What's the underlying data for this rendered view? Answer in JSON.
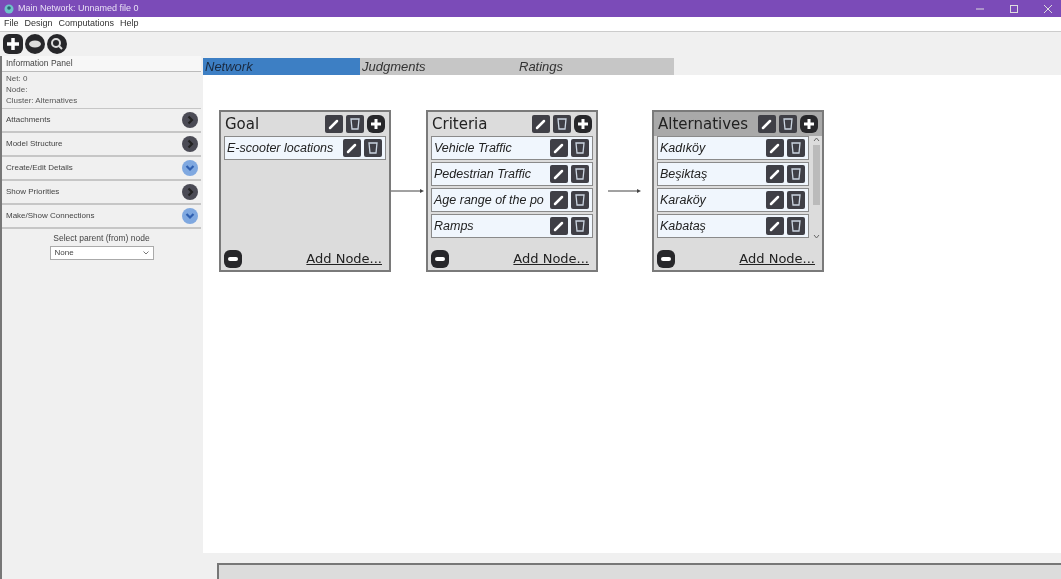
{
  "window": {
    "title": "Main Network: Unnamed file 0"
  },
  "menu": [
    "File",
    "Design",
    "Computations",
    "Help"
  ],
  "toolbar": [
    {
      "kind": "plus"
    },
    {
      "kind": "eye"
    },
    {
      "kind": "search"
    }
  ],
  "info_panel": {
    "title": "Information Panel",
    "lines": [
      "Net: 0",
      "Node:",
      "Cluster: Alternatives"
    ]
  },
  "sections": [
    {
      "label": "Attachments",
      "expanded": false
    },
    {
      "label": "Model Structure",
      "expanded": false
    },
    {
      "label": "Create/Edit Details",
      "expanded": true
    },
    {
      "label": "Show Priorities",
      "expanded": false
    },
    {
      "label": "Make/Show Connections",
      "expanded": true
    }
  ],
  "parent_select": {
    "label": "Select parent (from) node",
    "value": "None"
  },
  "tabs": [
    {
      "label": "Network",
      "selected": true
    },
    {
      "label": "Judgments",
      "selected": false
    },
    {
      "label": "Ratings",
      "selected": false
    }
  ],
  "clusters": [
    {
      "name": "Goal",
      "selected": false,
      "scrollable": false,
      "add_label": "Add Node...",
      "nodes": [
        "E-scooter locations"
      ]
    },
    {
      "name": "Criteria",
      "selected": false,
      "scrollable": false,
      "add_label": "Add Node...",
      "nodes": [
        "Vehicle Traffic",
        "Pedestrian Traffic",
        "Age range of the po",
        "Ramps"
      ]
    },
    {
      "name": "Alternatives",
      "selected": true,
      "scrollable": true,
      "add_label": "Add Node...",
      "nodes": [
        "Kadıköy",
        "Beşiktaş",
        "Karaköy",
        "Kabataş"
      ]
    }
  ]
}
